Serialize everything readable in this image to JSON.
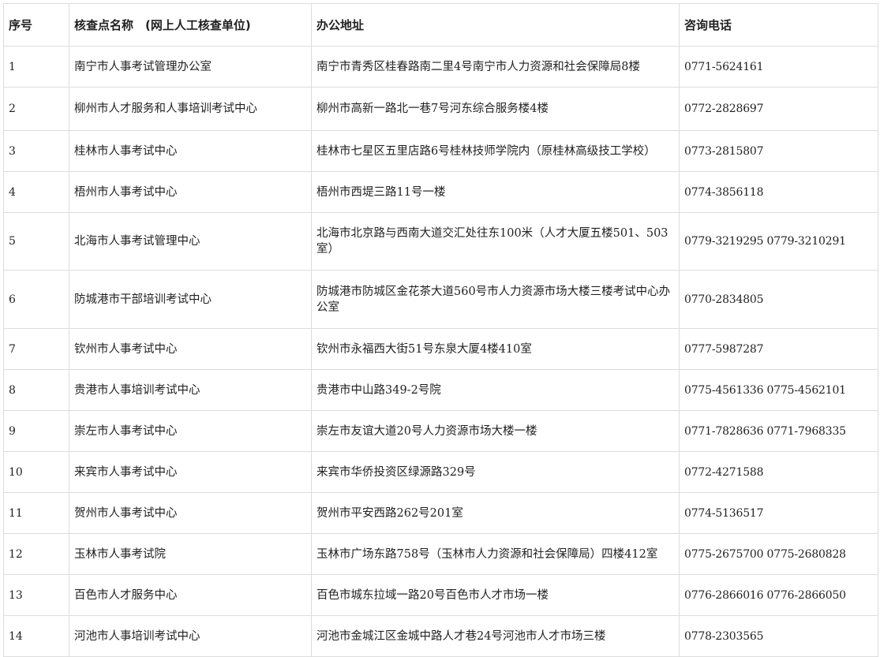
{
  "table": {
    "headers": {
      "no": "序号",
      "name": "核查点名称　(网上人工核查单位)",
      "address": "办公地址",
      "phone": "咨询电话"
    },
    "rows": [
      {
        "no": "1",
        "name": "南宁市人事考试管理办公室",
        "address": "南宁市青秀区桂春路南二里4号南宁市人力资源和社会保障局8楼",
        "phone": "0771-5624161"
      },
      {
        "no": "2",
        "name": "柳州市人才服务和人事培训考试中心",
        "address": "柳州市高新一路北一巷7号河东综合服务楼4楼",
        "phone": "0772-2828697"
      },
      {
        "no": "3",
        "name": "桂林市人事考试中心",
        "address": "桂林市七星区五里店路6号桂林技师学院内（原桂林高级技工学校）",
        "phone": "0773-2815807"
      },
      {
        "no": "4",
        "name": "梧州市人事考试中心",
        "address": "梧州市西堤三路11号一楼",
        "phone": "0774-3856118"
      },
      {
        "no": "5",
        "name": "北海市人事考试管理中心",
        "address": "北海市北京路与西南大道交汇处往东100米（人才大厦五楼501、503室）",
        "phone": "0779-3219295  0779-3210291"
      },
      {
        "no": "6",
        "name": "防城港市干部培训考试中心",
        "address": "防城港市防城区金花茶大道560号市人力资源市场大楼三楼考试中心办公室",
        "phone": "0770-2834805"
      },
      {
        "no": "7",
        "name": "钦州市人事考试中心",
        "address": "钦州市永福西大街51号东泉大厦4楼410室",
        "phone": "0777-5987287"
      },
      {
        "no": "8",
        "name": "贵港市人事培训考试中心",
        "address": "贵港市中山路349-2号院",
        "phone": "0775-4561336  0775-4562101"
      },
      {
        "no": "9",
        "name": "崇左市人事考试中心",
        "address": "崇左市友谊大道20号人力资源市场大楼一楼",
        "phone": "0771-7828636  0771-7968335"
      },
      {
        "no": "10",
        "name": "来宾市人事考试中心",
        "address": "来宾市华侨投资区绿源路329号",
        "phone": "0772-4271588"
      },
      {
        "no": "11",
        "name": "贺州市人事考试中心",
        "address": "贺州市平安西路262号201室",
        "phone": "0774-5136517"
      },
      {
        "no": "12",
        "name": "玉林市人事考试院",
        "address": "玉林市广场东路758号（玉林市人力资源和社会保障局）四楼412室",
        "phone": "0775-2675700  0775-2680828"
      },
      {
        "no": "13",
        "name": "百色市人才服务中心",
        "address": "百色市城东拉域一路20号百色市人才市场一楼",
        "phone": "0776-2866016  0776-2866050"
      },
      {
        "no": "14",
        "name": "河池市人事培训考试中心",
        "address": "河池市金城江区金城中路人才巷24号河池市人才市场三楼",
        "phone": "0778-2303565"
      }
    ]
  }
}
